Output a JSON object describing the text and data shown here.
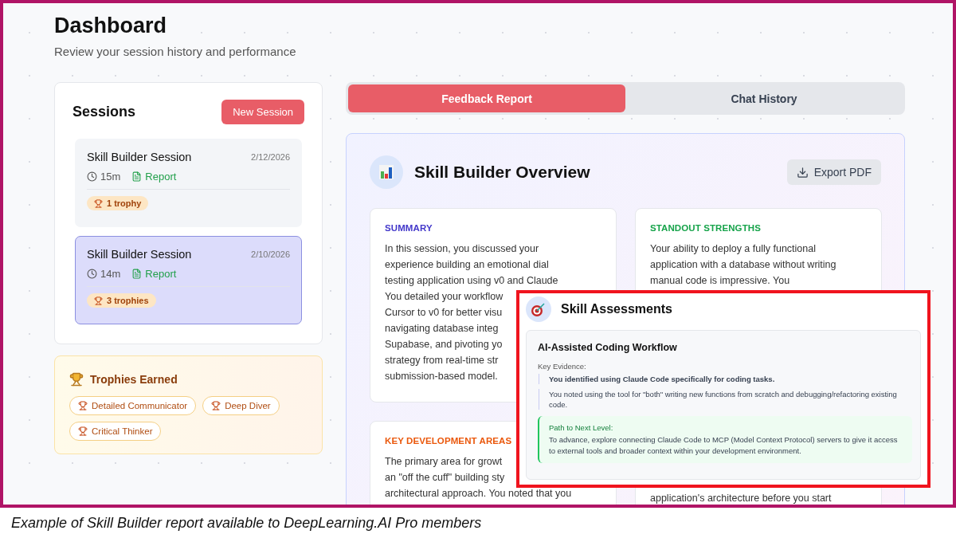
{
  "header": {
    "title": "Dashboard",
    "subtitle": "Review your session history and performance"
  },
  "sessions": {
    "title": "Sessions",
    "new_button": "New Session",
    "items": [
      {
        "title": "Skill Builder Session",
        "date": "2/12/2026",
        "duration": "15m",
        "report": "Report",
        "trophies": "1 trophy",
        "selected": false
      },
      {
        "title": "Skill Builder Session",
        "date": "2/10/2026",
        "duration": "14m",
        "report": "Report",
        "trophies": "3 trophies",
        "selected": true
      }
    ]
  },
  "trophies": {
    "title": "Trophies Earned",
    "badges": [
      "Detailed Communicator",
      "Deep Diver",
      "Critical Thinker"
    ]
  },
  "tabs": [
    {
      "label": "Feedback Report",
      "selected": true
    },
    {
      "label": "Chat History",
      "selected": false
    }
  ],
  "overview": {
    "title": "Skill Builder Overview",
    "export_button": "Export PDF",
    "cards": [
      {
        "heading": "SUMMARY",
        "color": "#4338ca",
        "lines": [
          "In this session, you discussed your",
          "experience building an emotional dial",
          "testing application using v0 and Claude",
          "You detailed your workflow",
          "Cursor to v0 for better visu",
          "navigating database integ",
          "Supabase, and pivoting yo",
          "strategy from real-time str",
          "submission-based model."
        ]
      },
      {
        "heading": "STANDOUT STRENGTHS",
        "color": "#16a34a",
        "lines": [
          "Your ability to deploy a fully functional",
          "application with a database without writing",
          "manual code is impressive. You"
        ]
      },
      {
        "heading": "KEY DEVELOPMENT AREAS",
        "color": "#ea580c",
        "lines": [
          "The primary area for growt",
          "an \"off the cuff\" building sty",
          "architectural approach. You noted that you"
        ]
      },
      {
        "lines": [
          "application's architecture before you start"
        ]
      }
    ]
  },
  "assessments": {
    "title": "Skill Assessments",
    "skill": {
      "name": "AI-Assisted Coding Workflow",
      "evidence_label": "Key Evidence:",
      "evidence": [
        {
          "text": "You identified using Claude Code specifically for coding tasks.",
          "emphasized": true
        },
        {
          "text": "You noted using the tool for \"both\" writing new functions from scratch and debugging/refactoring existing code.",
          "emphasized": false
        }
      ],
      "next_label": "Path to Next Level:",
      "next_text": "To advance, explore connecting Claude Code to MCP (Model Context Protocol) servers to give it access to external tools and broader context within your development environment."
    }
  },
  "caption": "Example of Skill Builder report available to DeepLearning.AI Pro members"
}
